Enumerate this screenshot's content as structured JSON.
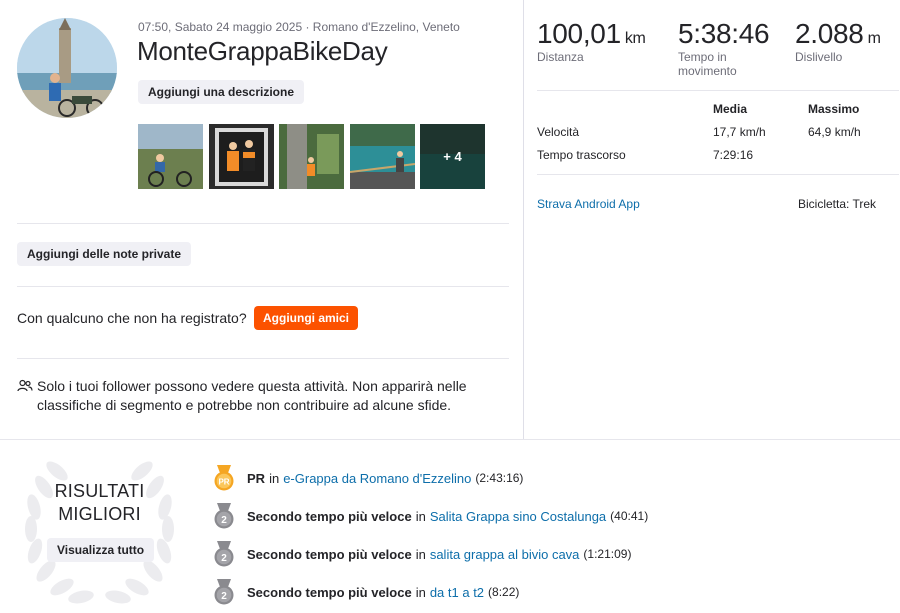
{
  "activity": {
    "meta": "07:50, Sabato 24 maggio 2025 · Romano d'Ezzelino, Veneto",
    "title": "MonteGrappaBikeDay",
    "add_description_label": "Aggiungi una descrizione",
    "photos_more_label": "+ 4",
    "add_private_notes_label": "Aggiungi delle note private",
    "friends_question": "Con qualcuno che non ha registrato?",
    "add_friends_label": "Aggiungi amici",
    "privacy_text": "Solo i tuoi follower possono vedere questa attività. Non apparirà nelle classifiche di segmento e potrebbe non contribuire ad alcune sfide."
  },
  "stats": {
    "distance": {
      "value": "100,01",
      "unit": "km",
      "label": "Distanza"
    },
    "moving_time": {
      "value": "5:38:46",
      "label": "Tempo in movimento"
    },
    "elevation": {
      "value": "2.088",
      "unit": "m",
      "label": "Dislivello"
    }
  },
  "details_table": {
    "headers": [
      "Media",
      "Massimo"
    ],
    "rows": [
      {
        "label": "Velocità",
        "avg": "17,7 km/h",
        "max": "64,9 km/h"
      },
      {
        "label": "Tempo trascorso",
        "avg": "7:29:16",
        "max": ""
      }
    ]
  },
  "device": {
    "app": "Strava Android App",
    "bike": "Bicicletta: Trek"
  },
  "results": {
    "title": "RISULTATI MIGLIORI",
    "view_all_label": "Visualizza tutto",
    "in_word": "in",
    "items": [
      {
        "type": "PR",
        "medal_text": "PR",
        "title": "PR",
        "segment": "e-Grappa da Romano d'Ezzelino",
        "time": "(2:43:16)"
      },
      {
        "type": "2nd",
        "medal_text": "2",
        "title": "Secondo tempo più veloce",
        "segment": "Salita Grappa sino Costalunga",
        "time": "(40:41)"
      },
      {
        "type": "2nd",
        "medal_text": "2",
        "title": "Secondo tempo più veloce",
        "segment": "salita grappa al bivio cava",
        "time": "(1:21:09)"
      },
      {
        "type": "2nd",
        "medal_text": "2",
        "title": "Secondo tempo più veloce",
        "segment": "da t1 a t2",
        "time": "(8:22)"
      }
    ]
  },
  "colors": {
    "accent": "#fc5200",
    "link": "#0d6eaa",
    "pr_medal": "#f5a623",
    "silver_medal": "#8a8a8f"
  }
}
